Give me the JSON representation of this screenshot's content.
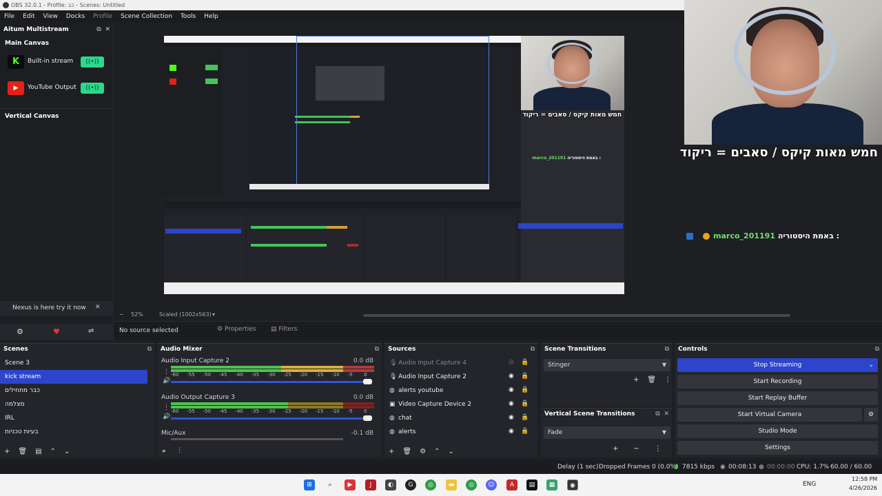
{
  "window": {
    "title": "OBS 32.0.1 - Profile: כב - Scenes: Untitled"
  },
  "menu": [
    "File",
    "Edit",
    "View",
    "Docks",
    "Profile",
    "Scene Collection",
    "Tools",
    "Help"
  ],
  "multistream": {
    "title": "Aitum Multistream",
    "main_canvas": "Main Canvas",
    "outputs": [
      {
        "label": "Built-in stream",
        "color": "#1bd96c"
      },
      {
        "label": "YouTube Output",
        "color": "#e62117"
      }
    ],
    "vertical_canvas": "Vertical Canvas",
    "nexus_banner": "Nexus is here try it now"
  },
  "overlay": {
    "caption": "חמש מאות קיקס / סאבים = ריקוד",
    "chat_user": "marco_201191",
    "chat_text": ": באמת היסטוריה"
  },
  "preview": {
    "zoom": "52%",
    "scaled": "Scaled (1002x563)"
  },
  "properties_bar": {
    "no_source": "No source selected",
    "properties": "Properties",
    "filters": "Filters"
  },
  "scenes": {
    "title": "Scenes",
    "items": [
      "Scene 3",
      "kick stream",
      "כבר מתחילים",
      "מצלמה",
      "IRL",
      "בעיות טכניות"
    ],
    "selected": 1
  },
  "audio_mixer": {
    "title": "Audio Mixer",
    "channels": [
      {
        "name": "Audio Input Capture 2",
        "db": "0.0 dB",
        "level": 1.0
      },
      {
        "name": "Audio Output Capture 3",
        "db": "0.0 dB",
        "level": 1.0
      },
      {
        "name": "Mic/Aux",
        "db": "-0.1 dB",
        "level": 0.998
      }
    ],
    "scale": [
      "-60",
      "-55",
      "-50",
      "-45",
      "-40",
      "-35",
      "-30",
      "-25",
      "-20",
      "-15",
      "-10",
      "-5",
      "0"
    ]
  },
  "sources": {
    "title": "Sources",
    "items": [
      {
        "name": "Audio Input Capture 4",
        "icon": "mic-icon",
        "dim": true
      },
      {
        "name": "Audio Input Capture 2",
        "icon": "mic-icon",
        "dim": false
      },
      {
        "name": "alerts youtube",
        "icon": "globe-icon",
        "dim": false
      },
      {
        "name": "Video Capture Device 2",
        "icon": "camera-icon",
        "dim": false
      },
      {
        "name": "chat",
        "icon": "globe-icon",
        "dim": false
      },
      {
        "name": "alerts",
        "icon": "globe-icon",
        "dim": false
      }
    ]
  },
  "scene_transitions": {
    "title": "Scene Transitions",
    "value": "Stinger"
  },
  "vertical_transitions": {
    "title": "Vertical Scene Transitions",
    "value": "Fade"
  },
  "controls": {
    "title": "Controls",
    "buttons": [
      "Stop Streaming",
      "Start Recording",
      "Start Replay Buffer",
      "Start Virtual Camera",
      "Studio Mode",
      "Settings"
    ]
  },
  "status": {
    "delay": "Delay (1 sec)",
    "dropped": "Dropped Frames 0 (0.0%)",
    "bitrate": "7815 kbps",
    "stream_time": "00:08:13",
    "rec_time": "00:00:00",
    "cpu": "CPU: 1.7%",
    "fps": "60.00 / 60.00 FPS"
  },
  "taskbar": {
    "lang": "ENG",
    "time": "12:58 PM",
    "date": "4/26/2026"
  },
  "colors": {
    "accent": "#2c45cc",
    "kick": "#53fc18",
    "youtube": "#e62117",
    "toggle": "#2bd98c"
  }
}
